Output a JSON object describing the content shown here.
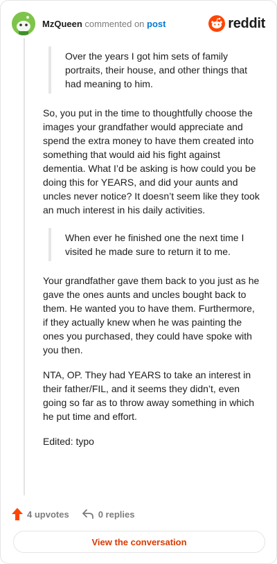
{
  "comment": {
    "author": "MzQueen",
    "action_text": "commented on",
    "target": "post",
    "brand": "reddit"
  },
  "body": {
    "quote1": "Over the years I got him sets of family portraits, their house, and other things that had meaning to him.",
    "para1": "So, you put in the time to thoughtfully choose the images your grandfather would appreciate and spend the extra money to have them created into something that would aid his fight against dementia. What I’d be asking is how could you be doing this for YEARS, and did your aunts and uncles never notice? It doesn’t seem like they took an much interest in his daily activities.",
    "quote2": "When ever he finished one the next time I visited he made sure to return it to me.",
    "para2": "Your grandfather gave them back to you just as he gave the ones aunts and uncles bought back to them. He wanted you to have them. Furthermore, if they actually knew when he was painting the ones you purchased, they could have spoke with you then.",
    "para3": "NTA, OP. They had YEARS to take an interest in their father/FIL, and it seems they didn’t, even going so far as to throw away something in which he put time and effort.",
    "para4": "Edited: typo"
  },
  "footer": {
    "upvotes": "4 upvotes",
    "replies": "0 replies",
    "cta": "View the conversation"
  },
  "icons": {
    "upvote": "upvote-arrow-icon",
    "reply": "reply-arrow-icon",
    "brand": "reddit-snoo-icon",
    "avatar": "snoo-avatar"
  },
  "colors": {
    "accent": "#ff4500",
    "link": "#0079d3",
    "cta_text": "#d93a00",
    "muted": "#7c7c7c",
    "avatar_bg": "#7ec44b"
  }
}
